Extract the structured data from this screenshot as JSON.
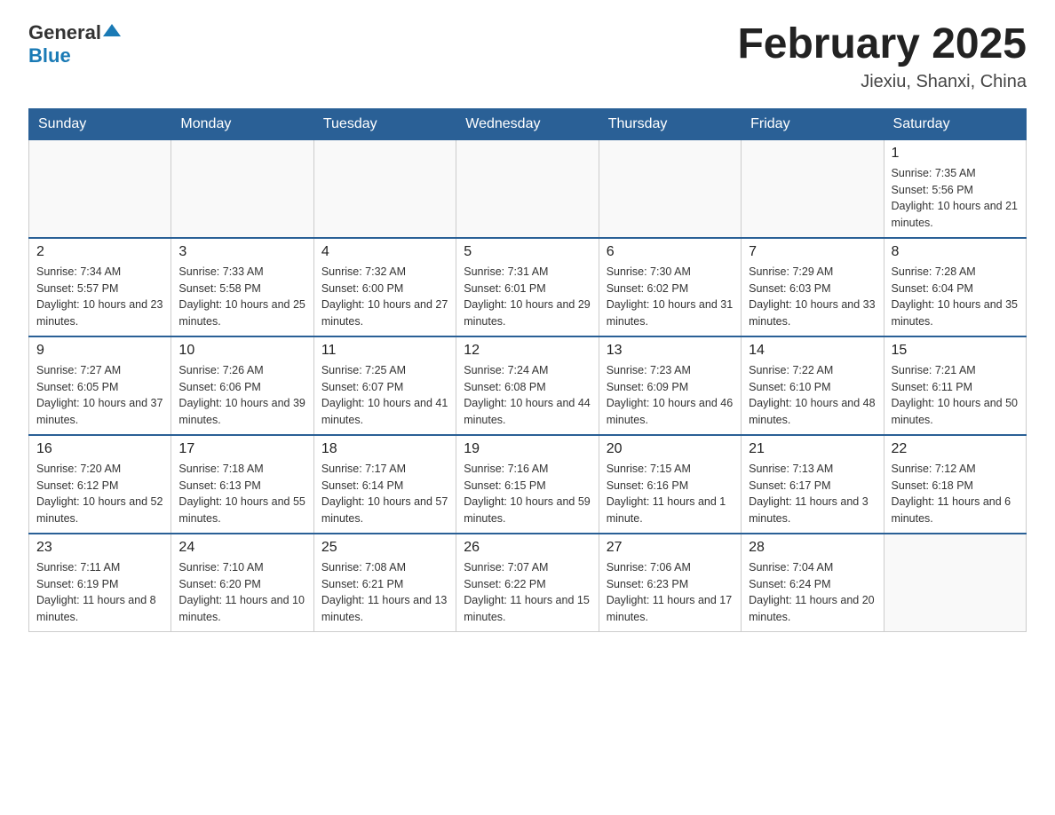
{
  "logo": {
    "general": "General",
    "blue": "Blue"
  },
  "header": {
    "title": "February 2025",
    "subtitle": "Jiexiu, Shanxi, China"
  },
  "weekdays": [
    "Sunday",
    "Monday",
    "Tuesday",
    "Wednesday",
    "Thursday",
    "Friday",
    "Saturday"
  ],
  "weeks": [
    [
      {
        "day": "",
        "info": ""
      },
      {
        "day": "",
        "info": ""
      },
      {
        "day": "",
        "info": ""
      },
      {
        "day": "",
        "info": ""
      },
      {
        "day": "",
        "info": ""
      },
      {
        "day": "",
        "info": ""
      },
      {
        "day": "1",
        "info": "Sunrise: 7:35 AM\nSunset: 5:56 PM\nDaylight: 10 hours and 21 minutes."
      }
    ],
    [
      {
        "day": "2",
        "info": "Sunrise: 7:34 AM\nSunset: 5:57 PM\nDaylight: 10 hours and 23 minutes."
      },
      {
        "day": "3",
        "info": "Sunrise: 7:33 AM\nSunset: 5:58 PM\nDaylight: 10 hours and 25 minutes."
      },
      {
        "day": "4",
        "info": "Sunrise: 7:32 AM\nSunset: 6:00 PM\nDaylight: 10 hours and 27 minutes."
      },
      {
        "day": "5",
        "info": "Sunrise: 7:31 AM\nSunset: 6:01 PM\nDaylight: 10 hours and 29 minutes."
      },
      {
        "day": "6",
        "info": "Sunrise: 7:30 AM\nSunset: 6:02 PM\nDaylight: 10 hours and 31 minutes."
      },
      {
        "day": "7",
        "info": "Sunrise: 7:29 AM\nSunset: 6:03 PM\nDaylight: 10 hours and 33 minutes."
      },
      {
        "day": "8",
        "info": "Sunrise: 7:28 AM\nSunset: 6:04 PM\nDaylight: 10 hours and 35 minutes."
      }
    ],
    [
      {
        "day": "9",
        "info": "Sunrise: 7:27 AM\nSunset: 6:05 PM\nDaylight: 10 hours and 37 minutes."
      },
      {
        "day": "10",
        "info": "Sunrise: 7:26 AM\nSunset: 6:06 PM\nDaylight: 10 hours and 39 minutes."
      },
      {
        "day": "11",
        "info": "Sunrise: 7:25 AM\nSunset: 6:07 PM\nDaylight: 10 hours and 41 minutes."
      },
      {
        "day": "12",
        "info": "Sunrise: 7:24 AM\nSunset: 6:08 PM\nDaylight: 10 hours and 44 minutes."
      },
      {
        "day": "13",
        "info": "Sunrise: 7:23 AM\nSunset: 6:09 PM\nDaylight: 10 hours and 46 minutes."
      },
      {
        "day": "14",
        "info": "Sunrise: 7:22 AM\nSunset: 6:10 PM\nDaylight: 10 hours and 48 minutes."
      },
      {
        "day": "15",
        "info": "Sunrise: 7:21 AM\nSunset: 6:11 PM\nDaylight: 10 hours and 50 minutes."
      }
    ],
    [
      {
        "day": "16",
        "info": "Sunrise: 7:20 AM\nSunset: 6:12 PM\nDaylight: 10 hours and 52 minutes."
      },
      {
        "day": "17",
        "info": "Sunrise: 7:18 AM\nSunset: 6:13 PM\nDaylight: 10 hours and 55 minutes."
      },
      {
        "day": "18",
        "info": "Sunrise: 7:17 AM\nSunset: 6:14 PM\nDaylight: 10 hours and 57 minutes."
      },
      {
        "day": "19",
        "info": "Sunrise: 7:16 AM\nSunset: 6:15 PM\nDaylight: 10 hours and 59 minutes."
      },
      {
        "day": "20",
        "info": "Sunrise: 7:15 AM\nSunset: 6:16 PM\nDaylight: 11 hours and 1 minute."
      },
      {
        "day": "21",
        "info": "Sunrise: 7:13 AM\nSunset: 6:17 PM\nDaylight: 11 hours and 3 minutes."
      },
      {
        "day": "22",
        "info": "Sunrise: 7:12 AM\nSunset: 6:18 PM\nDaylight: 11 hours and 6 minutes."
      }
    ],
    [
      {
        "day": "23",
        "info": "Sunrise: 7:11 AM\nSunset: 6:19 PM\nDaylight: 11 hours and 8 minutes."
      },
      {
        "day": "24",
        "info": "Sunrise: 7:10 AM\nSunset: 6:20 PM\nDaylight: 11 hours and 10 minutes."
      },
      {
        "day": "25",
        "info": "Sunrise: 7:08 AM\nSunset: 6:21 PM\nDaylight: 11 hours and 13 minutes."
      },
      {
        "day": "26",
        "info": "Sunrise: 7:07 AM\nSunset: 6:22 PM\nDaylight: 11 hours and 15 minutes."
      },
      {
        "day": "27",
        "info": "Sunrise: 7:06 AM\nSunset: 6:23 PM\nDaylight: 11 hours and 17 minutes."
      },
      {
        "day": "28",
        "info": "Sunrise: 7:04 AM\nSunset: 6:24 PM\nDaylight: 11 hours and 20 minutes."
      },
      {
        "day": "",
        "info": ""
      }
    ]
  ]
}
